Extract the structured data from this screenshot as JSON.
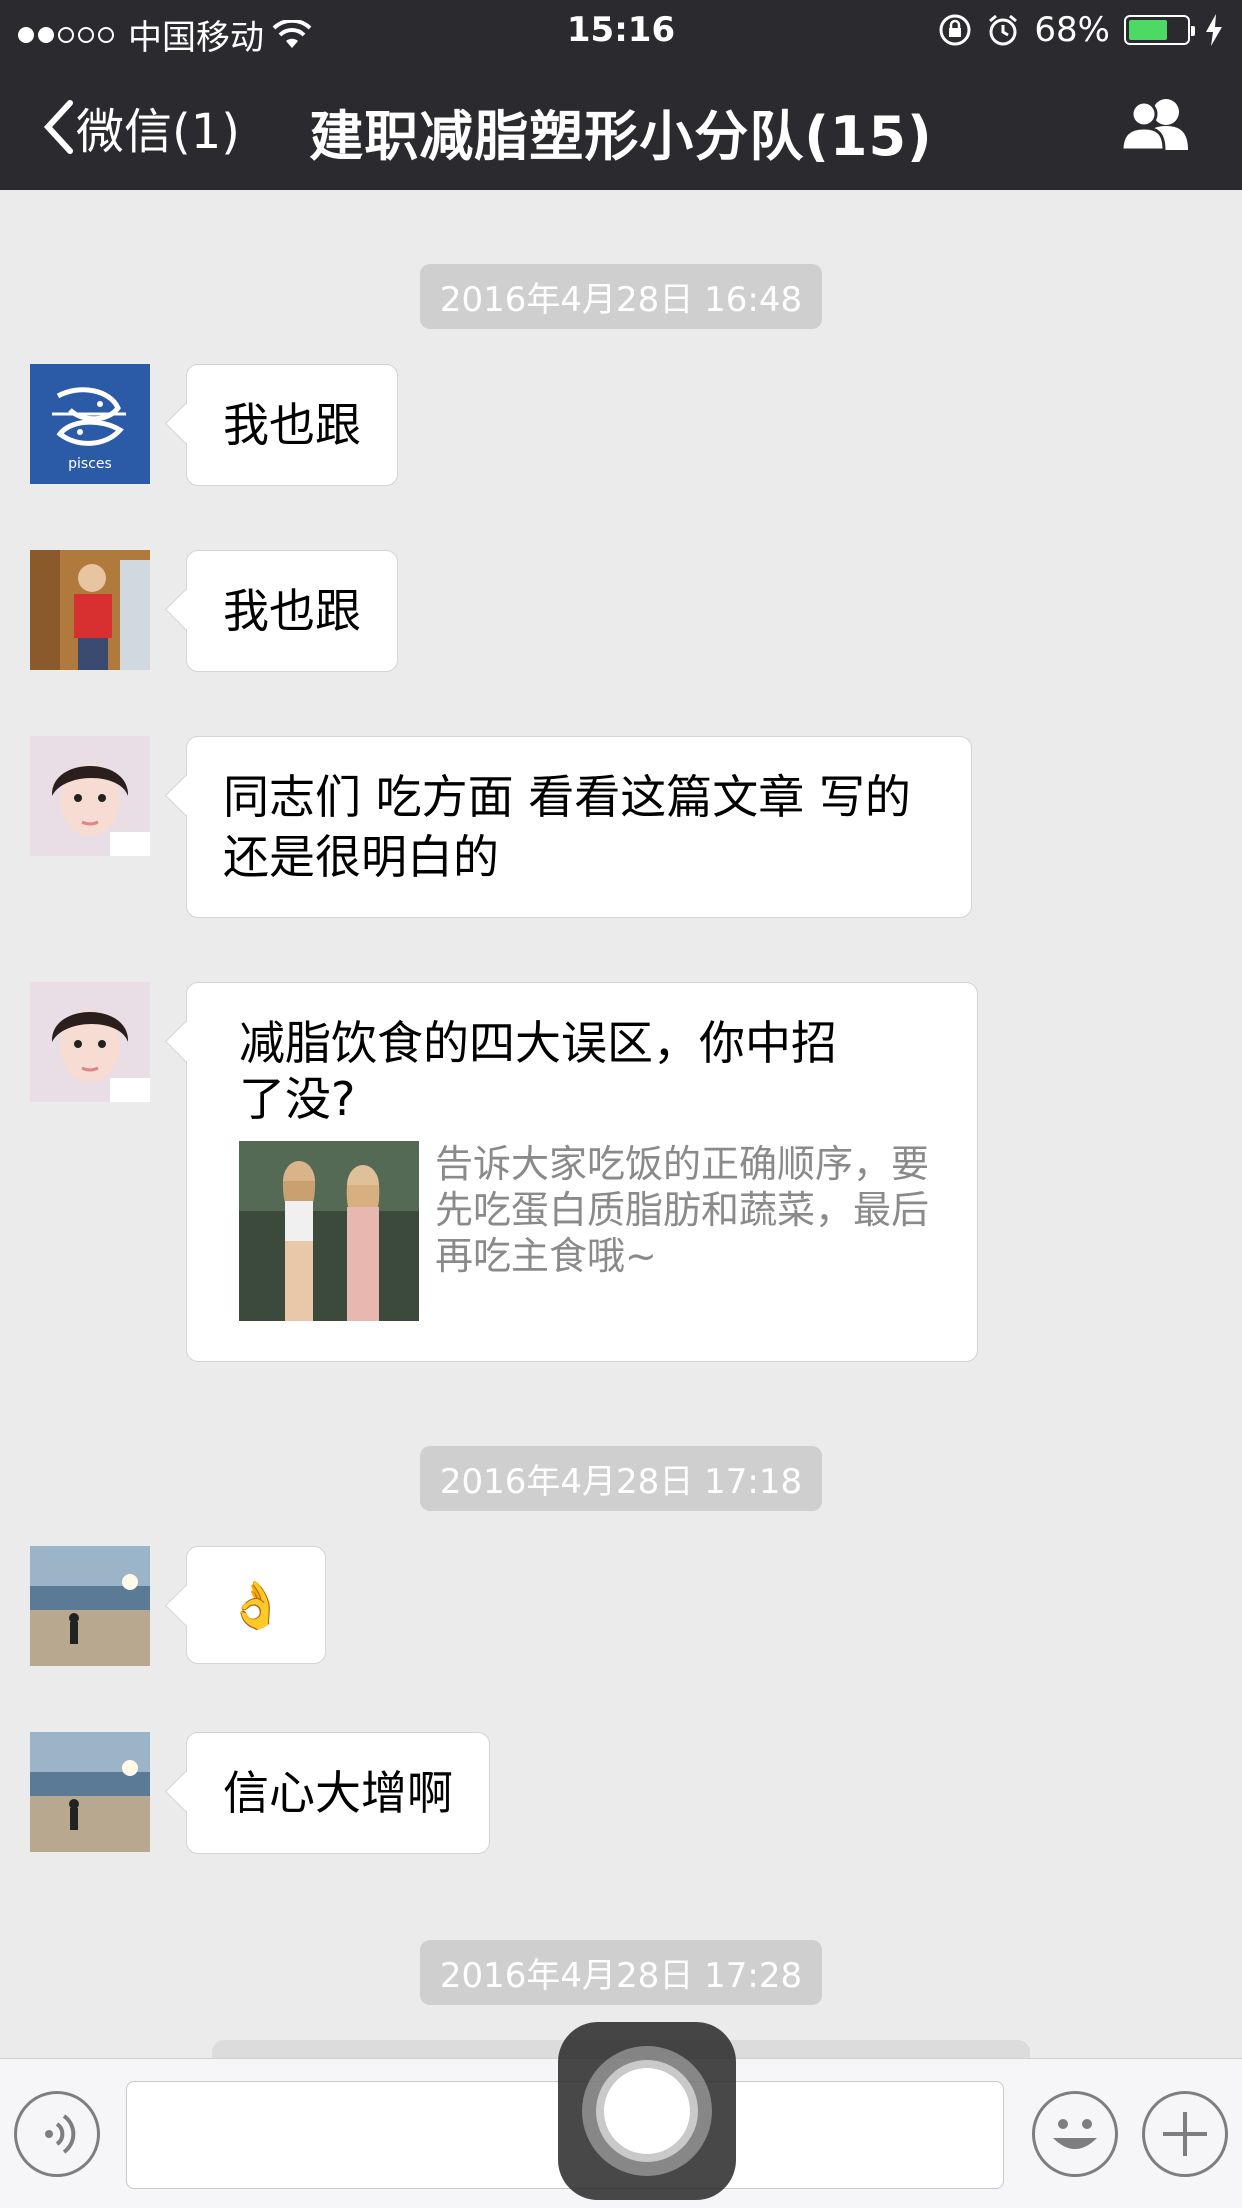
{
  "status_bar": {
    "carrier": "中国移动",
    "time": "15:16",
    "battery": "68%",
    "battery_level": 0.68
  },
  "nav": {
    "back_label": "微信(1)",
    "title": "建职减脂塑形小分队(15)"
  },
  "messages": {
    "ts1": "2016年4月28日 16:48",
    "m1": "我也跟",
    "m2": "我也跟",
    "m3_line1": "同志们 吃方面 看看这篇文章 写的",
    "m3_line2": "还是很明白的",
    "article": {
      "title": "减脂饮食的四大误区，你中招了没?",
      "desc": "告诉大家吃饭的正确顺序，要先吃蛋白质脂肪和蔬菜，最后再吃主食哦~"
    },
    "ts2": "2016年4月28日 17:18",
    "m5": "👌",
    "m6": "信心大增啊",
    "ts3": "2016年4月28日 17:28"
  },
  "avatar_labels": {
    "pisces": "pisces"
  },
  "colors": {
    "nav_bg": "#2b2a2f",
    "chat_bg": "#ebebeb",
    "battery": "#4cd964",
    "timestamp_bg": "#cfcfcf"
  },
  "icons": {
    "voice": "voice-icon",
    "emoji": "emoji-icon",
    "plus": "plus-icon",
    "members": "group-members-icon",
    "back": "chevron-left-icon"
  }
}
